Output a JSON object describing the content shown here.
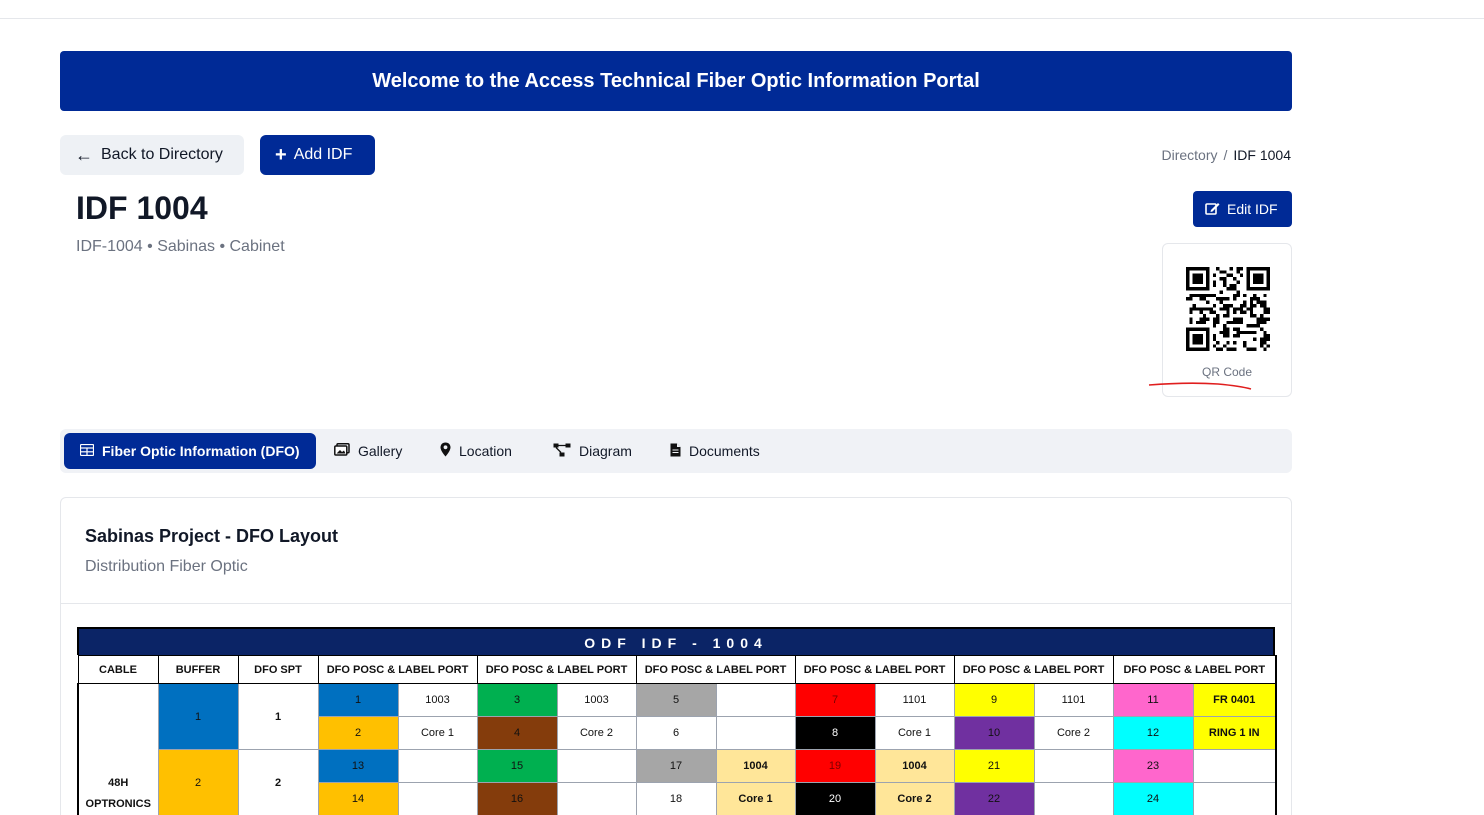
{
  "banner": {
    "text": "Welcome to the Access Technical Fiber Optic Information Portal"
  },
  "actions": {
    "back_label": "Back to Directory",
    "add_label": "Add IDF",
    "edit_label": "Edit IDF"
  },
  "breadcrumb": {
    "root": "Directory",
    "separator": "/",
    "current": "IDF 1004"
  },
  "idf": {
    "title": "IDF 1004",
    "subtitle": "IDF-1004 • Sabinas • Cabinet"
  },
  "qr": {
    "label": "QR Code"
  },
  "tabs": [
    {
      "label": "Fiber Optic Information (DFO)",
      "icon": "table-icon",
      "active": true
    },
    {
      "label": "Gallery",
      "icon": "images-icon"
    },
    {
      "label": "Location",
      "icon": "map-pin-icon"
    },
    {
      "label": "Diagram",
      "icon": "diagram-icon"
    },
    {
      "label": "Documents",
      "icon": "file-icon"
    }
  ],
  "panel": {
    "title": "Sabinas Project - DFO Layout",
    "subtitle": "Distribution Fiber Optic"
  },
  "odf": {
    "title": "ODF IDF - 1004",
    "headers": [
      "CABLE",
      "BUFFER",
      "DFO SPT",
      "DFO POSC & LABEL PORT",
      "DFO POSC & LABEL PORT",
      "DFO POSC & LABEL PORT",
      "DFO POSC & LABEL PORT",
      "DFO POSC & LABEL PORT",
      "DFO POSC & LABEL PORT"
    ],
    "cable_line1": "48H",
    "cable_line2": "OPTRONICS",
    "buffers": [
      "1",
      "2"
    ],
    "spt": [
      "1",
      "2"
    ],
    "rows": [
      [
        [
          "1",
          "#0070c0"
        ],
        [
          "1003",
          "#ffffff"
        ],
        [
          "3",
          "#00b050"
        ],
        [
          "1003",
          "#ffffff"
        ],
        [
          "5",
          "#a6a6a6"
        ],
        [
          "",
          "#ffffff"
        ],
        [
          "7",
          "#ff0000"
        ],
        [
          "1101",
          "#ffffff"
        ],
        [
          "9",
          "#ffff00"
        ],
        [
          "1101",
          "#ffffff"
        ],
        [
          "11",
          "#ff66cc"
        ],
        [
          "FR 0401",
          "#ffff00"
        ]
      ],
      [
        [
          "2",
          "#ffc000"
        ],
        [
          "Core 1",
          "#ffffff"
        ],
        [
          "4",
          "#843c0c"
        ],
        [
          "Core 2",
          "#ffffff"
        ],
        [
          "6",
          "#ffffff"
        ],
        [
          "",
          "#ffffff"
        ],
        [
          "8",
          "#000000"
        ],
        [
          "Core 1",
          "#ffffff"
        ],
        [
          "10",
          "#7030a0"
        ],
        [
          "Core 2",
          "#ffffff"
        ],
        [
          "12",
          "#00ffff"
        ],
        [
          "RING 1 IN",
          "#ffff00"
        ]
      ],
      [
        [
          "13",
          "#0070c0"
        ],
        [
          "",
          "#ffffff"
        ],
        [
          "15",
          "#00b050"
        ],
        [
          "",
          "#ffffff"
        ],
        [
          "17",
          "#a6a6a6"
        ],
        [
          "1004",
          "#ffe699"
        ],
        [
          "19",
          "#ff0000"
        ],
        [
          "1004",
          "#ffe699"
        ],
        [
          "21",
          "#ffff00"
        ],
        [
          "",
          "#ffffff"
        ],
        [
          "23",
          "#ff66cc"
        ],
        [
          "",
          "#ffffff"
        ]
      ],
      [
        [
          "14",
          "#ffc000"
        ],
        [
          "",
          "#ffffff"
        ],
        [
          "16",
          "#843c0c"
        ],
        [
          "",
          "#ffffff"
        ],
        [
          "18",
          "#ffffff"
        ],
        [
          "Core 1",
          "#ffe699"
        ],
        [
          "20",
          "#000000"
        ],
        [
          "Core 2",
          "#ffe699"
        ],
        [
          "22",
          "#7030a0"
        ],
        [
          "",
          "#ffffff"
        ],
        [
          "24",
          "#00ffff"
        ],
        [
          "",
          "#ffffff"
        ]
      ]
    ]
  },
  "colors": {
    "brand": "#002a96",
    "annotation": "#e01e1e"
  }
}
